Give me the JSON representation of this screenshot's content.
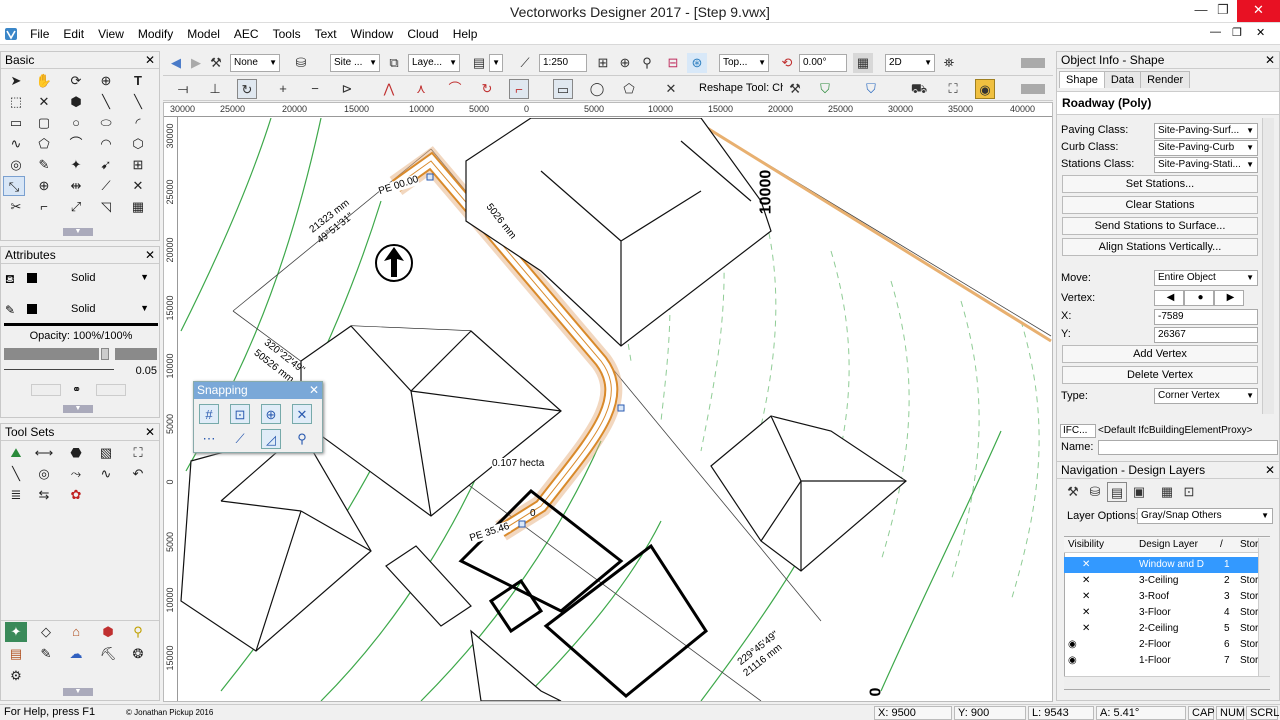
{
  "window": {
    "title": "Vectorworks Designer 2017 - [Step 9.vwx]",
    "min": "—",
    "restore": "❐",
    "close": "✕",
    "doc_min": "—",
    "doc_restore": "❐",
    "doc_close": "✕"
  },
  "menu": [
    "File",
    "Edit",
    "View",
    "Modify",
    "Model",
    "AEC",
    "Tools",
    "Text",
    "Window",
    "Cloud",
    "Help"
  ],
  "basic_palette": {
    "title": "Basic"
  },
  "attributes": {
    "title": "Attributes",
    "fill_style": "Solid",
    "pen_style": "Solid",
    "opacity": "Opacity: 100%/100%",
    "line_weight": "0.05"
  },
  "tool_sets": {
    "title": "Tool Sets"
  },
  "view_bar": {
    "class_sel": "None",
    "class2": "Site ...",
    "layer": "Laye...",
    "scale": "1:250",
    "view": "Top...",
    "rotation": "0.00°",
    "render": "2D"
  },
  "mode_bar": {
    "reshape": "Reshape Tool: Cha"
  },
  "ruler_h": [
    "30000",
    "25000",
    "20000",
    "15000",
    "10000",
    "5000",
    "0",
    "5000",
    "10000",
    "15000",
    "20000",
    "25000",
    "30000",
    "35000",
    "40000"
  ],
  "ruler_v": [
    "30000",
    "25000",
    "20000",
    "15000",
    "10000",
    "5000",
    "0",
    "5000",
    "10000",
    "15000"
  ],
  "drawing": {
    "pe_start": "PE 00.00",
    "pe_end": "PE 35.46",
    "dim1": "21323 mm",
    "dim1b": "49°51'31\"",
    "dim2": "5026 mm",
    "dim3": "320°22'49\"",
    "dim3b": "50526 mm",
    "area": "0.107 hecta",
    "zero": "0",
    "big_label": "10000",
    "big_label2": "0",
    "dim4": "229°45'49\"",
    "dim4b": "21116 mm"
  },
  "snapping": {
    "title": "Snapping"
  },
  "object_info": {
    "title": "Object Info - Shape",
    "tabs": [
      "Shape",
      "Data",
      "Render"
    ],
    "object_type": "Roadway (Poly)",
    "paving_class_label": "Paving Class:",
    "paving_class": "Site-Paving-Surf...",
    "curb_class_label": "Curb Class:",
    "curb_class": "Site-Paving-Curb",
    "stations_class_label": "Stations Class:",
    "stations_class": "Site-Paving-Stati...",
    "btn_set_stations": "Set Stations...",
    "btn_clear_stations": "Clear Stations",
    "btn_send_stations": "Send Stations to Surface...",
    "btn_align": "Align Stations Vertically...",
    "move_label": "Move:",
    "move_value": "Entire Object",
    "vertex_label": "Vertex:",
    "x_label": "X:",
    "x_value": "-7589",
    "y_label": "Y:",
    "y_value": "26367",
    "btn_add_vertex": "Add Vertex",
    "btn_delete_vertex": "Delete Vertex",
    "type_label": "Type:",
    "type_value": "Corner Vertex",
    "ifc": "IFC...",
    "ifc_value": "<Default IfcBuildingElementProxy>",
    "name_label": "Name:"
  },
  "navigation": {
    "title": "Navigation - Design Layers",
    "layer_options_label": "Layer Options:",
    "layer_options": "Gray/Snap Others",
    "headers": {
      "visibility": "Visibility",
      "design_layer": "Design Layer",
      "slash": "/",
      "story": "Stor"
    },
    "layers": [
      {
        "vis": "✕",
        "name": "Window and D",
        "num": "1",
        "story": ""
      },
      {
        "vis": "✕",
        "name": "3-Ceiling",
        "num": "2",
        "story": "Stor"
      },
      {
        "vis": "✕",
        "name": "3-Roof",
        "num": "3",
        "story": "Stor"
      },
      {
        "vis": "✕",
        "name": "3-Floor",
        "num": "4",
        "story": "Stor"
      },
      {
        "vis": "✕",
        "name": "2-Ceiling",
        "num": "5",
        "story": "Stor"
      },
      {
        "vis": "◉",
        "name": "2-Floor",
        "num": "6",
        "story": "Stor"
      },
      {
        "vis": "◉",
        "name": "1-Floor",
        "num": "7",
        "story": "Stor"
      }
    ]
  },
  "status": {
    "help": "For Help, press F1",
    "credit": "© Jonathan Pickup 2016",
    "x": "X: 9500",
    "y": "Y: 900",
    "l": "L: 9543",
    "a": "A: 5.41°",
    "cap": "CAP",
    "num": "NUM",
    "scrl": "SCRL"
  }
}
